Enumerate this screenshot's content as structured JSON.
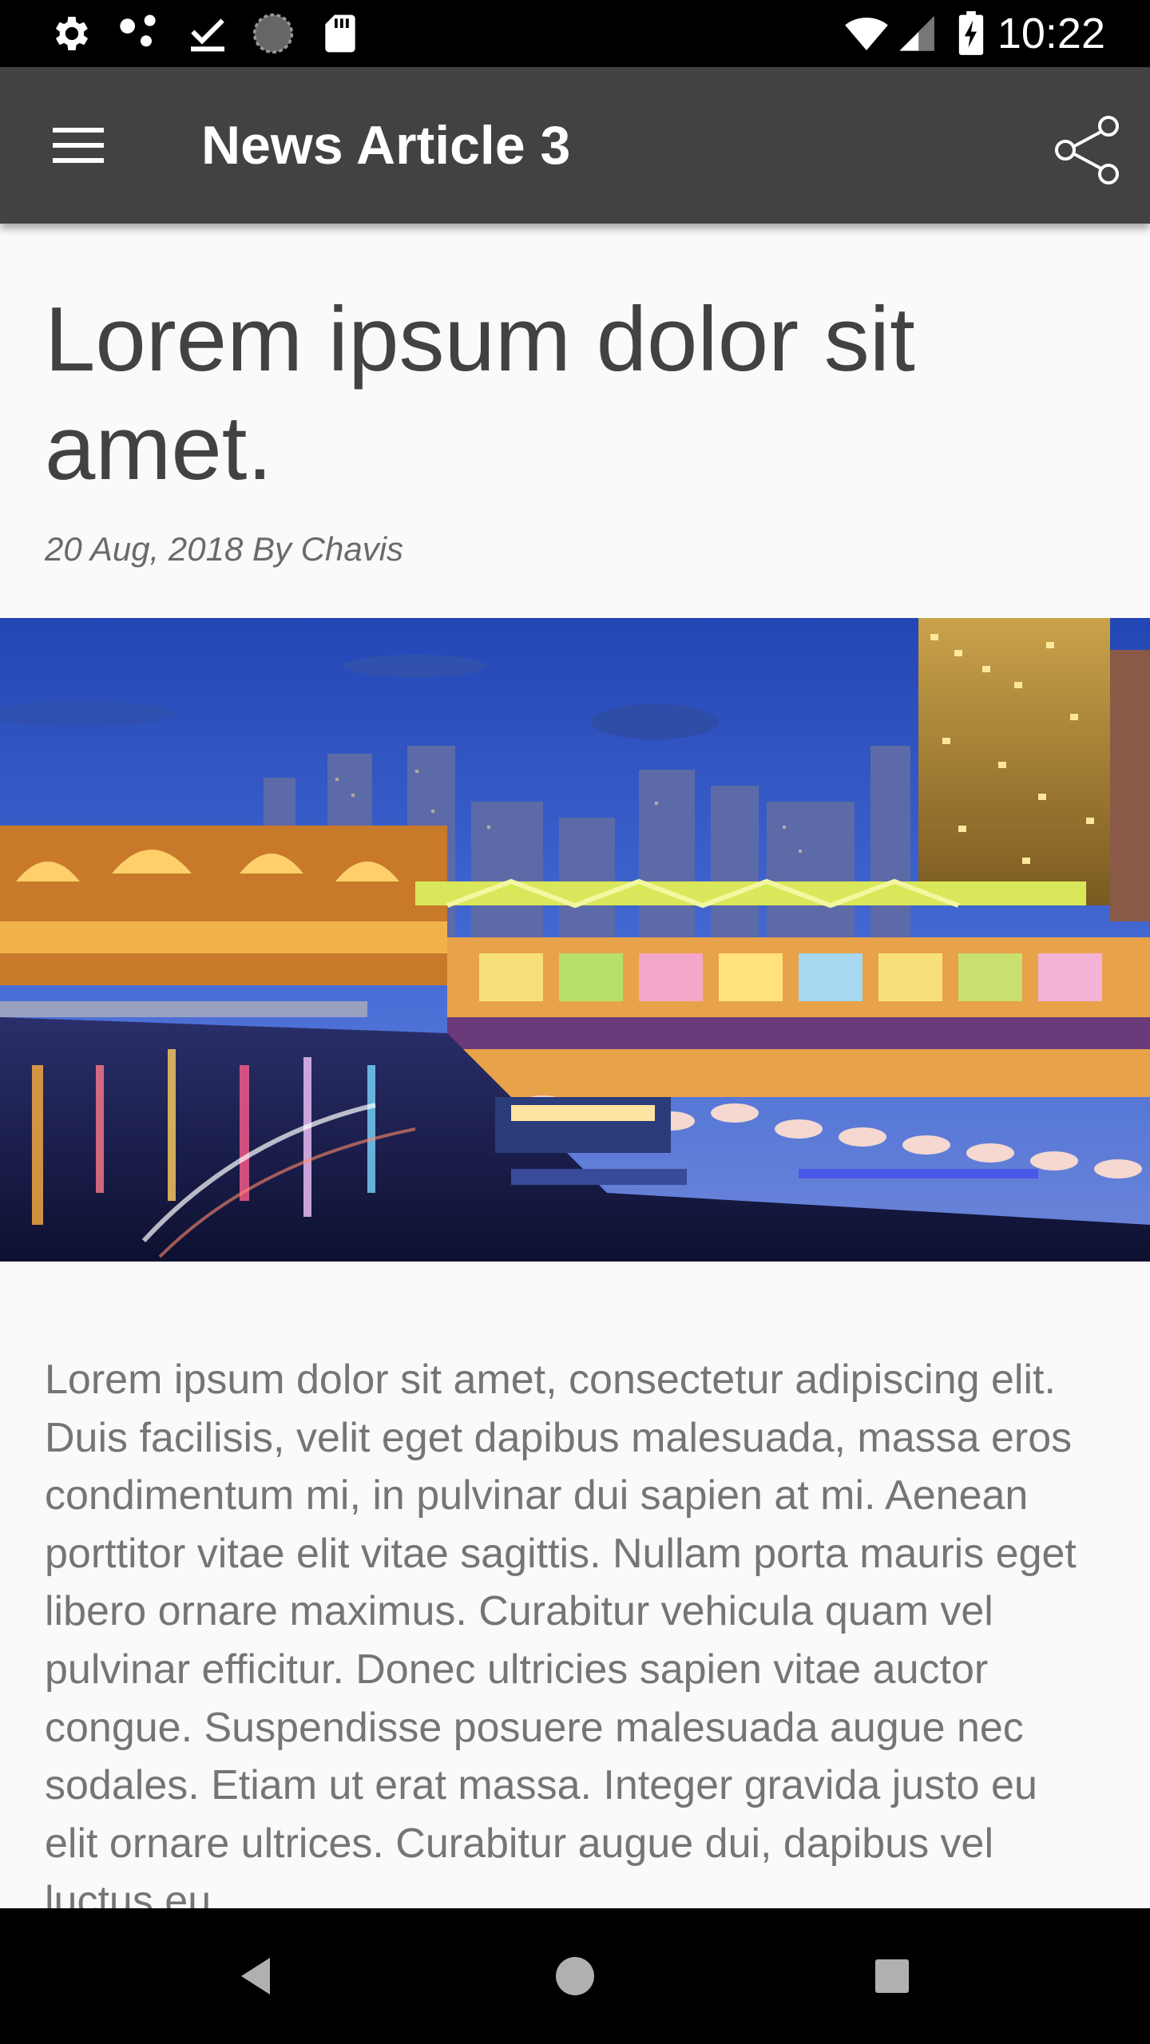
{
  "status_bar": {
    "time": "10:22",
    "left_icons": [
      "settings-icon",
      "share-dots-icon",
      "download-done-icon",
      "loading-icon",
      "sd-card-icon"
    ],
    "right_icons": [
      "wifi-icon",
      "cell-signal-icon",
      "battery-charging-icon"
    ]
  },
  "toolbar": {
    "title": "News Article 3",
    "menu_icon": "hamburger-menu-icon",
    "share_icon": "share-icon"
  },
  "article": {
    "headline": "Lorem ipsum dolor sit amet.",
    "meta": "20 Aug, 2018 By Chavis",
    "body": "Lorem ipsum dolor sit amet, consectetur adipiscing elit. Duis facilisis, velit eget dapibus malesuada, massa eros condimentum mi, in pulvinar dui sapien at mi. Aenean porttitor vitae elit vitae sagittis. Nullam porta mauris eget libero ornare maximus. Curabitur vehicula quam vel pulvinar efficitur. Donec ultricies sapien vitae auctor congue. Suspendisse posuere malesuada augue nec sodales. Etiam ut erat massa. Integer gravida justo eu elit ornare ultrices. Curabitur augue dui, dapibus vel luctus eu"
  },
  "nav_bar": {
    "back_icon": "back-triangle-icon",
    "home_icon": "home-circle-icon",
    "recents_icon": "recents-square-icon"
  },
  "colors": {
    "toolbar": "#424242",
    "page_background": "#fafafa",
    "headline": "#424242",
    "body_text": "#757575"
  }
}
